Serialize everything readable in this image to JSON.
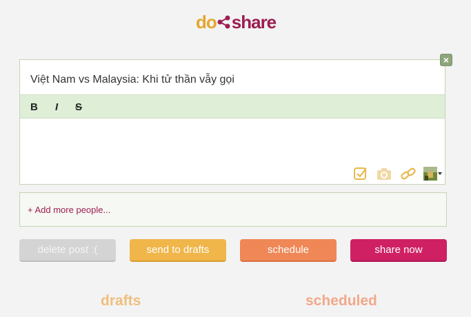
{
  "brand": {
    "part1": "do",
    "part2": "share",
    "colors": {
      "do": "#e4a72e",
      "share": "#9b1e52"
    }
  },
  "editor": {
    "title": "Việt Nam vs Malaysia: Khi tử thần vẫy gọi",
    "close_icon": "close-icon",
    "format": {
      "bold": "B",
      "italic": "I",
      "strike": "S"
    },
    "body": "",
    "tools": [
      "checkbox-icon",
      "camera-icon",
      "link-icon",
      "avatar-dropdown"
    ]
  },
  "people": {
    "add_label": "+ Add more people..."
  },
  "actions": {
    "delete": "delete post :(",
    "drafts": "send to drafts",
    "schedule": "schedule",
    "share": "share now"
  },
  "sections": {
    "drafts": "drafts",
    "scheduled": "scheduled"
  }
}
